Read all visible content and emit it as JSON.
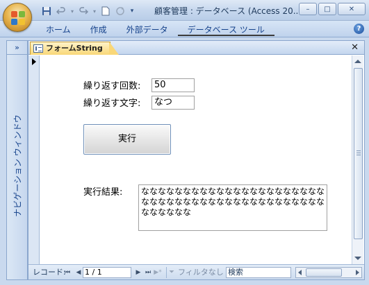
{
  "window": {
    "title": "顧客管理 : データベース (Access 20...",
    "buttons": {
      "minimize": "–",
      "maximize": "□",
      "close": "✕"
    }
  },
  "quick_access": {
    "icons": [
      "save-icon",
      "undo-icon",
      "redo-icon",
      "new-icon",
      "refresh-icon",
      "customize-icon"
    ]
  },
  "ribbon": {
    "tabs": [
      {
        "label": "ホーム"
      },
      {
        "label": "作成"
      },
      {
        "label": "外部データ"
      },
      {
        "label": "データベース ツール"
      }
    ],
    "help": "?"
  },
  "nav_pane": {
    "toggle": "»",
    "label": "ナビゲーション ウィンドウ"
  },
  "document": {
    "tab_title": "フォームString",
    "close": "✕"
  },
  "form": {
    "repeat_count_label": "繰り返す回数:",
    "repeat_count_value": "50",
    "repeat_text_label": "繰り返す文字:",
    "repeat_text_value": "なつ",
    "run_button": "実行",
    "result_label": "実行結果:",
    "result_value": "なななななななななななななななななななななななななななななななななななななななななななななななななな"
  },
  "record_nav": {
    "label": "レコード:",
    "position": "1 / 1",
    "filter": "フィルタなし",
    "search_placeholder": "検索"
  }
}
